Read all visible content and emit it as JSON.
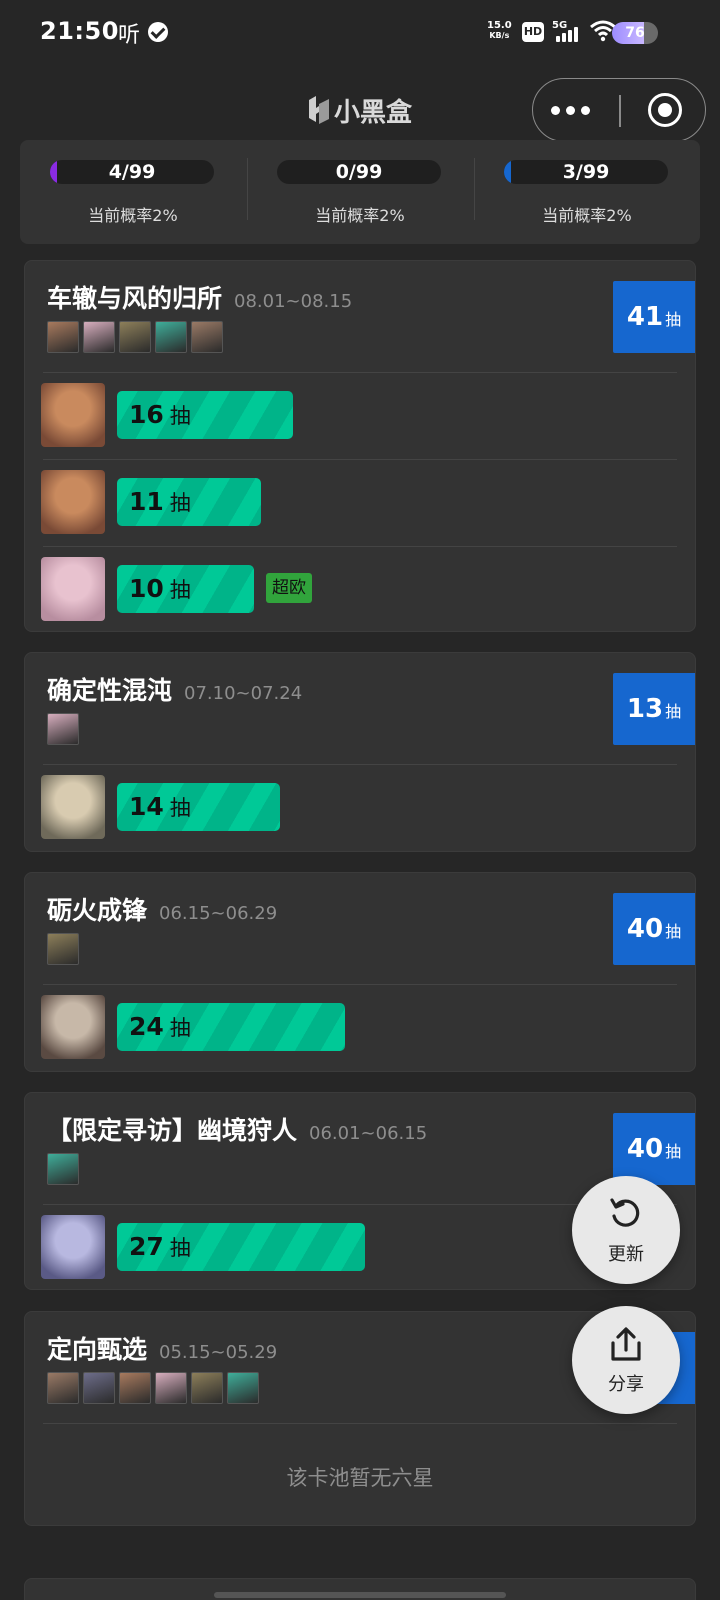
{
  "status_bar": {
    "time": "21:50",
    "listen_label": "听",
    "net_speed_value": "15.0",
    "net_speed_unit": "KB/s",
    "hd_label": "HD",
    "network_label": "5G",
    "battery": "76"
  },
  "nav": {
    "title": "小黑盒"
  },
  "summary": [
    {
      "text": "4/99",
      "probability": "当前概率2%",
      "progress": 0.04,
      "color": "#8a2be2"
    },
    {
      "text": "0/99",
      "probability": "当前概率2%",
      "progress": 0.0,
      "color": "#1667cf"
    },
    {
      "text": "3/99",
      "probability": "当前概率2%",
      "progress": 0.03,
      "color": "#1667cf"
    }
  ],
  "banners": [
    {
      "title": "车辙与风的归所",
      "date": "08.01~08.15",
      "total_pulls": "41",
      "pull_unit": "抽",
      "avatar_count": 5,
      "rows": [
        {
          "count": "16",
          "unit": "抽",
          "fraction": 0.16,
          "tag": ""
        },
        {
          "count": "11",
          "unit": "抽",
          "fraction": 0.11,
          "tag": ""
        },
        {
          "count": "10",
          "unit": "抽",
          "fraction": 0.1,
          "tag": "超欧"
        }
      ]
    },
    {
      "title": "确定性混沌",
      "date": "07.10~07.24",
      "total_pulls": "13",
      "pull_unit": "抽",
      "avatar_count": 1,
      "rows": [
        {
          "count": "14",
          "unit": "抽",
          "fraction": 0.14,
          "tag": ""
        }
      ]
    },
    {
      "title": "砺火成锋",
      "date": "06.15~06.29",
      "total_pulls": "40",
      "pull_unit": "抽",
      "avatar_count": 1,
      "rows": [
        {
          "count": "24",
          "unit": "抽",
          "fraction": 0.24,
          "tag": ""
        }
      ]
    },
    {
      "title": "【限定寻访】幽境狩人",
      "date": "06.01~06.15",
      "total_pulls": "40",
      "pull_unit": "抽",
      "avatar_count": 1,
      "rows": [
        {
          "count": "27",
          "unit": "抽",
          "fraction": 0.27,
          "tag": ""
        }
      ]
    },
    {
      "title": "定向甄选",
      "date": "05.15~05.29",
      "total_pulls": "",
      "pull_unit": "抽",
      "avatar_count": 6,
      "empty_note": "该卡池暂无六星",
      "rows": []
    }
  ],
  "fab": {
    "refresh_label": "更新",
    "share_label": "分享"
  },
  "colors": {
    "background": "#262626",
    "card": "#333333",
    "badge_blue": "#1667cf",
    "bar_green": "#00c997",
    "super_tag": "#31a43c"
  }
}
